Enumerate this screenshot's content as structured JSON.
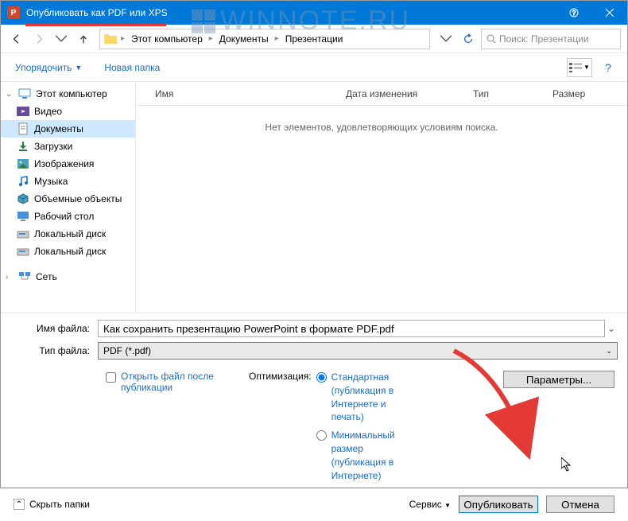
{
  "window": {
    "title": "Опубликовать как PDF или XPS",
    "app_icon_letter": "P"
  },
  "watermark": "WINNOTE.RU",
  "breadcrumb": {
    "items": [
      "Этот компьютер",
      "Документы",
      "Презентации"
    ]
  },
  "search": {
    "placeholder": "Поиск: Презентации"
  },
  "toolbar": {
    "organize": "Упорядочить",
    "new_folder": "Новая папка"
  },
  "columns": {
    "name": "Имя",
    "date": "Дата изменения",
    "type": "Тип",
    "size": "Размер"
  },
  "empty": "Нет элементов, удовлетворяющих условиям поиска.",
  "sidebar": {
    "items": [
      {
        "label": "Этот компьютер",
        "root": true
      },
      {
        "label": "Видео"
      },
      {
        "label": "Документы",
        "selected": true
      },
      {
        "label": "Загрузки"
      },
      {
        "label": "Изображения"
      },
      {
        "label": "Музыка"
      },
      {
        "label": "Объемные объекты"
      },
      {
        "label": "Рабочий стол"
      },
      {
        "label": "Локальный диск"
      },
      {
        "label": "Локальный диск"
      },
      {
        "label": "Сеть",
        "root": true,
        "gap": true
      }
    ]
  },
  "form": {
    "filename_label": "Имя файла:",
    "filename_value": "Как сохранить презентацию PowerPoint в формате PDF.pdf",
    "filetype_label": "Тип файла:",
    "filetype_value": "PDF (*.pdf)"
  },
  "options": {
    "open_after": "Открыть файл после публикации",
    "optimize_label": "Оптимизация:",
    "opt_std": "Стандартная (публикация в Интернете и печать)",
    "opt_min": "Минимальный размер (публикация в Интернете)",
    "params": "Параметры..."
  },
  "footer": {
    "hide": "Скрыть папки",
    "service": "Сервис",
    "publish": "Опубликовать",
    "cancel": "Отмена"
  }
}
